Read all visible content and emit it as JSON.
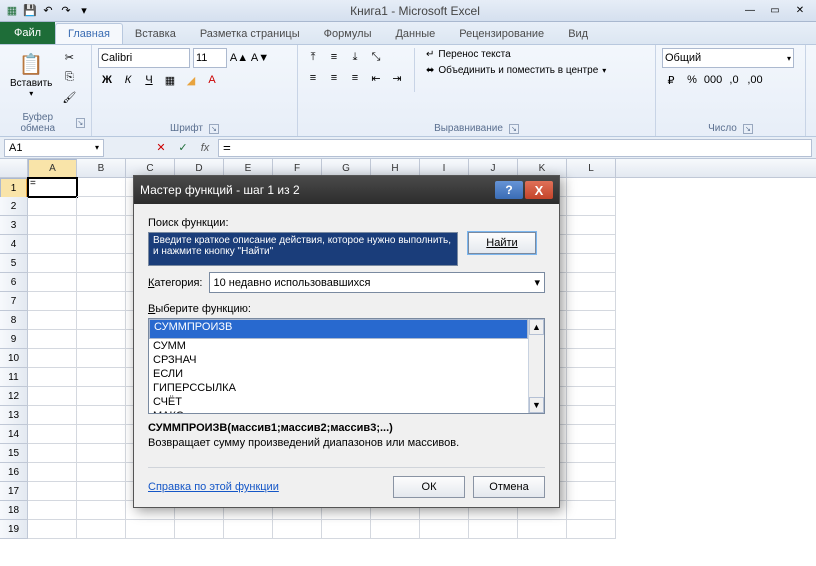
{
  "app": {
    "title": "Книга1 - Microsoft Excel"
  },
  "qat": {
    "save": "💾",
    "undo": "↶",
    "redo": "↷"
  },
  "tabs": {
    "file": "Файл",
    "items": [
      "Главная",
      "Вставка",
      "Разметка страницы",
      "Формулы",
      "Данные",
      "Рецензирование",
      "Вид"
    ]
  },
  "ribbon": {
    "clipboard": {
      "paste": "Вставить",
      "label": "Буфер обмена"
    },
    "font": {
      "name": "Calibri",
      "size": "11",
      "label": "Шрифт",
      "bold": "Ж",
      "italic": "К",
      "underline": "Ч"
    },
    "align": {
      "label": "Выравнивание",
      "wrap": "Перенос текста",
      "merge": "Объединить и поместить в центре"
    },
    "number": {
      "label": "Число",
      "format": "Общий"
    }
  },
  "formula": {
    "name_box": "A1",
    "fx": "fx",
    "value": "="
  },
  "grid": {
    "cols": [
      "A",
      "B",
      "C",
      "D",
      "E",
      "F",
      "G",
      "H",
      "I",
      "J",
      "K",
      "L"
    ],
    "rows": 19,
    "a1": "="
  },
  "dialog": {
    "title": "Мастер функций - шаг 1 из 2",
    "search_label": "Поиск функции:",
    "search_text": "Введите краткое описание действия, которое нужно выполнить, и нажмите кнопку \"Найти\"",
    "find": "Найти",
    "category_label": "Категория:",
    "category_underline": "К",
    "category_value": "10 недавно использовавшихся",
    "select_label": "Выберите функцию:",
    "select_underline": "В",
    "functions": [
      "СУММПРОИЗВ",
      "СУММ",
      "СРЗНАЧ",
      "ЕСЛИ",
      "ГИПЕРССЫЛКА",
      "СЧЁТ",
      "МАКС"
    ],
    "signature": "СУММПРОИЗВ(массив1;массив2;массив3;...)",
    "description": "Возвращает сумму произведений диапазонов или массивов.",
    "help_link": "Справка по этой функции",
    "ok": "ОК",
    "cancel": "Отмена"
  }
}
